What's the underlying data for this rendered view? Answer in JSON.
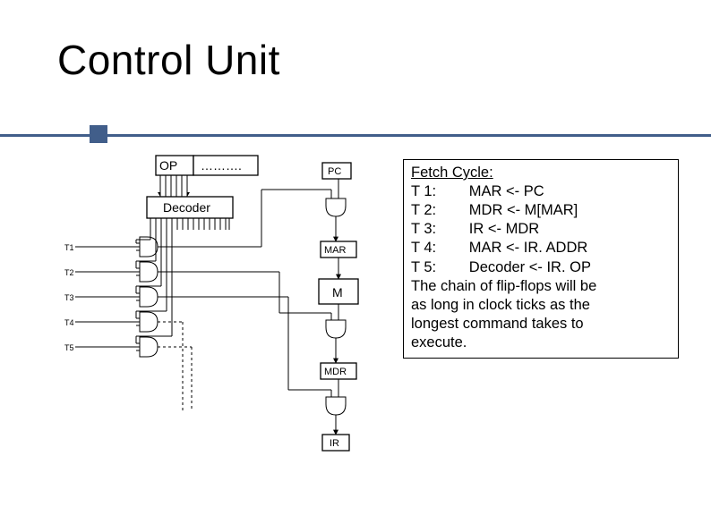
{
  "title": "Control Unit",
  "registers": {
    "op": "OP",
    "op_ellipsis": "……….",
    "decoder": "Decoder",
    "pc": "PC",
    "mar": "MAR",
    "m": "M",
    "mdr": "MDR",
    "ir": "IR"
  },
  "t_labels": [
    "T1",
    "T2",
    "T3",
    "T4",
    "T5"
  ],
  "description": {
    "heading": "Fetch Cycle:",
    "lines": [
      "T 1:        MAR <- PC",
      "T 2:        MDR <- M[MAR]",
      "T 3:        IR <- MDR",
      "T 4:        MAR <- IR. ADDR",
      "T 5:        Decoder <- IR. OP",
      "The chain of flip-flops will be",
      "as long in clock ticks as the",
      "longest command takes to",
      "execute."
    ]
  }
}
